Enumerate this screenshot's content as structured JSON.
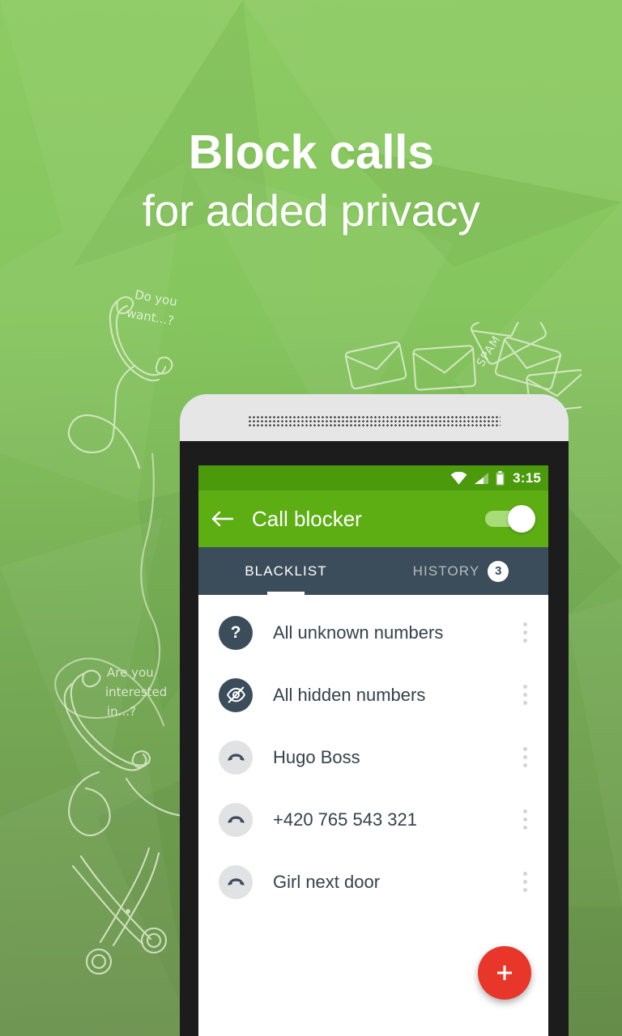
{
  "promo": {
    "headline_line1": "Block calls",
    "headline_line2": "for added privacy",
    "doodles": {
      "top_left_text_line1": "Do you",
      "top_left_text_line2": "want...?",
      "bottom_left_text_line1": "Are you",
      "bottom_left_text_line2": "interested",
      "bottom_left_text_line3": "in...?",
      "envelope_label": "SPAM"
    },
    "colors": {
      "background_top": "#8dcb63",
      "background_bottom": "#69904c",
      "doodle_stroke": "#e3efd4"
    }
  },
  "phone": {
    "statusbar": {
      "time": "3:15",
      "icons": [
        "wifi-icon",
        "signal-icon",
        "battery-icon"
      ],
      "background": "#4a9a0b"
    },
    "toolbar": {
      "back_icon": "back-arrow-icon",
      "title": "Call blocker",
      "toggle_on": true,
      "background": "#5cae13"
    },
    "tabs": {
      "background": "#3b4c5a",
      "items": [
        {
          "label": "BLACKLIST",
          "active": true,
          "badge": ""
        },
        {
          "label": "HISTORY",
          "active": false,
          "badge": "3"
        }
      ]
    },
    "list": [
      {
        "name": "All unknown numbers",
        "avatar_style": "dark",
        "icon": "question-mark-icon"
      },
      {
        "name": "All hidden numbers",
        "avatar_style": "dark",
        "icon": "eye-off-icon"
      },
      {
        "name": "Hugo Boss",
        "avatar_style": "light",
        "icon": "call-end-icon"
      },
      {
        "name": "+420 765 543 321",
        "avatar_style": "light",
        "icon": "call-end-icon"
      },
      {
        "name": "Girl next door",
        "avatar_style": "light",
        "icon": "call-end-icon"
      }
    ],
    "fab": {
      "icon": "plus-icon",
      "color": "#e8372a"
    }
  }
}
